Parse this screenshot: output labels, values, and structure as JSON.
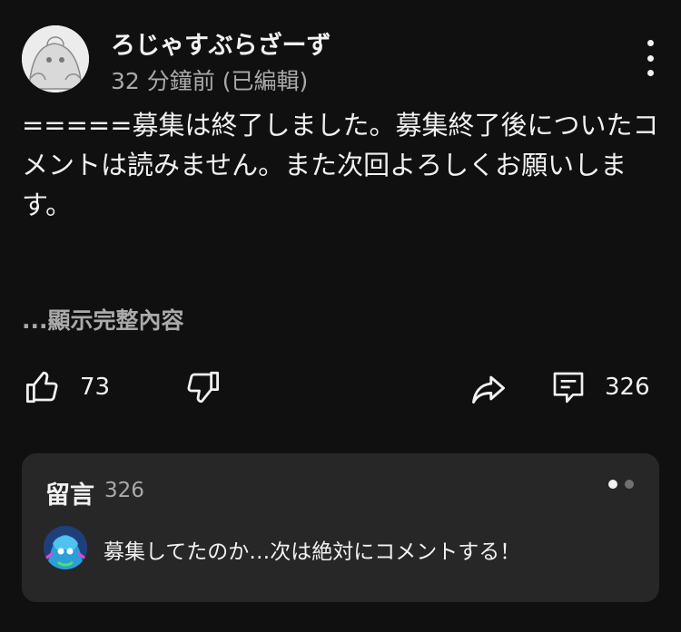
{
  "post": {
    "channel_name": "ろじゃすぶらざーず",
    "meta": "32 分鐘前 (已編輯)",
    "body": "=====募集は終了しました。募集終了後についたコメントは読みません。また次回よろしくお願いします。",
    "show_more": "...顯示完整內容"
  },
  "actions": {
    "like_icon": "thumbs-up-icon",
    "like_count": "73",
    "dislike_icon": "thumbs-down-icon",
    "share_icon": "share-icon",
    "comment_icon": "comment-icon",
    "comment_count": "326"
  },
  "comments_panel": {
    "title": "留言",
    "count": "326",
    "pager_pages": 2,
    "pager_active": 1,
    "top_comment_text": "募集してたのか…次は絶対にコメントする！"
  },
  "colors": {
    "background": "#101010",
    "panel": "#272727",
    "text_primary": "#f1f1f1",
    "text_secondary": "#aaaaaa"
  }
}
